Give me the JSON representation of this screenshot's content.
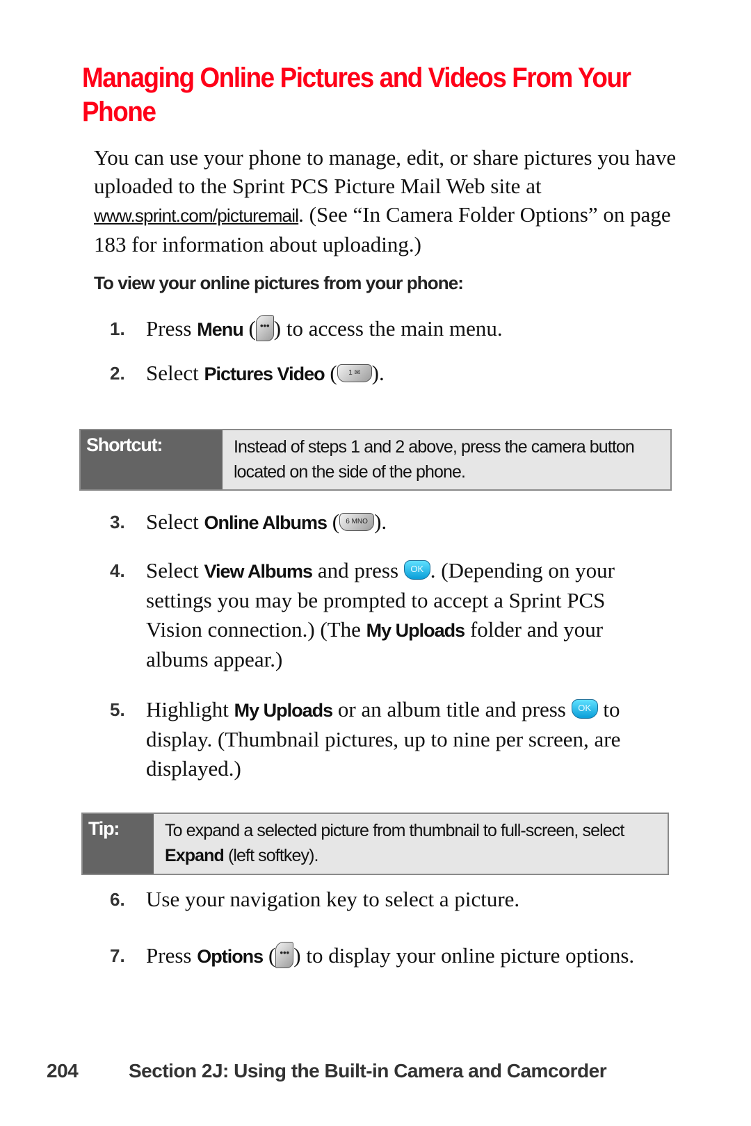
{
  "heading": "Managing Online Pictures and Videos From Your Phone",
  "intro": {
    "before_link": "You can use your phone to manage, edit, or share pictures you have uploaded to the Sprint PCS Picture Mail Web site at ",
    "link": "www.sprint.com/picturemail",
    "after_link": ". (See “In Camera Folder Options” on page 183 for information about uploading.)"
  },
  "subheading": "To view your online pictures from your phone:",
  "steps": [
    {
      "num": "1.",
      "pre": "Press ",
      "bold": "Menu",
      "mid": " (",
      "key": "•••",
      "post": ") to access the main menu."
    },
    {
      "num": "2.",
      "pre": "Select ",
      "bold": "Pictures Video",
      "mid": " (",
      "key": "1 ✉",
      "post": ")."
    },
    {
      "num": "3.",
      "pre": "Select ",
      "bold": "Online Albums",
      "mid": " (",
      "key": "6 MNO",
      "post": ")."
    },
    {
      "num": "4.",
      "pre": "Select ",
      "bold": "View Albums",
      "mid": " and press ",
      "key": "OK",
      "post": ". (Depending on your settings you may be prompted to accept a Sprint PCS Vision connection.) (The ",
      "bold2": "My Uploads",
      "post2": " folder and your albums appear.)"
    },
    {
      "num": "5.",
      "pre": "Highlight ",
      "bold": "My Uploads",
      "mid": " or an album title and press ",
      "key": "OK",
      "post": " to display. (Thumbnail pictures, up to nine per screen, are displayed.)"
    },
    {
      "num": "6.",
      "pre": "Use your navigation key to select a picture."
    },
    {
      "num": "7.",
      "pre": "Press ",
      "bold": "Options",
      "mid": " (",
      "key": "•••",
      "post": ") to display your online picture options."
    }
  ],
  "shortcut": {
    "label": "Shortcut:",
    "text": "Instead of steps 1 and 2 above, press the camera button located on the side of the phone."
  },
  "tip": {
    "label": "Tip:",
    "text_pre": "To expand a selected picture from thumbnail to full-screen, select ",
    "text_bold": "Expand",
    "text_post": " (left softkey)."
  },
  "footer": {
    "page_number": "204",
    "section": "Section 2J: Using the Built-in Camera and Camcorder"
  },
  "colors": {
    "heading": "#ff0018",
    "callout_label_bg": "#646464",
    "callout_text_bg": "#e6e6e6",
    "ok_key": "#0a9ed8"
  }
}
